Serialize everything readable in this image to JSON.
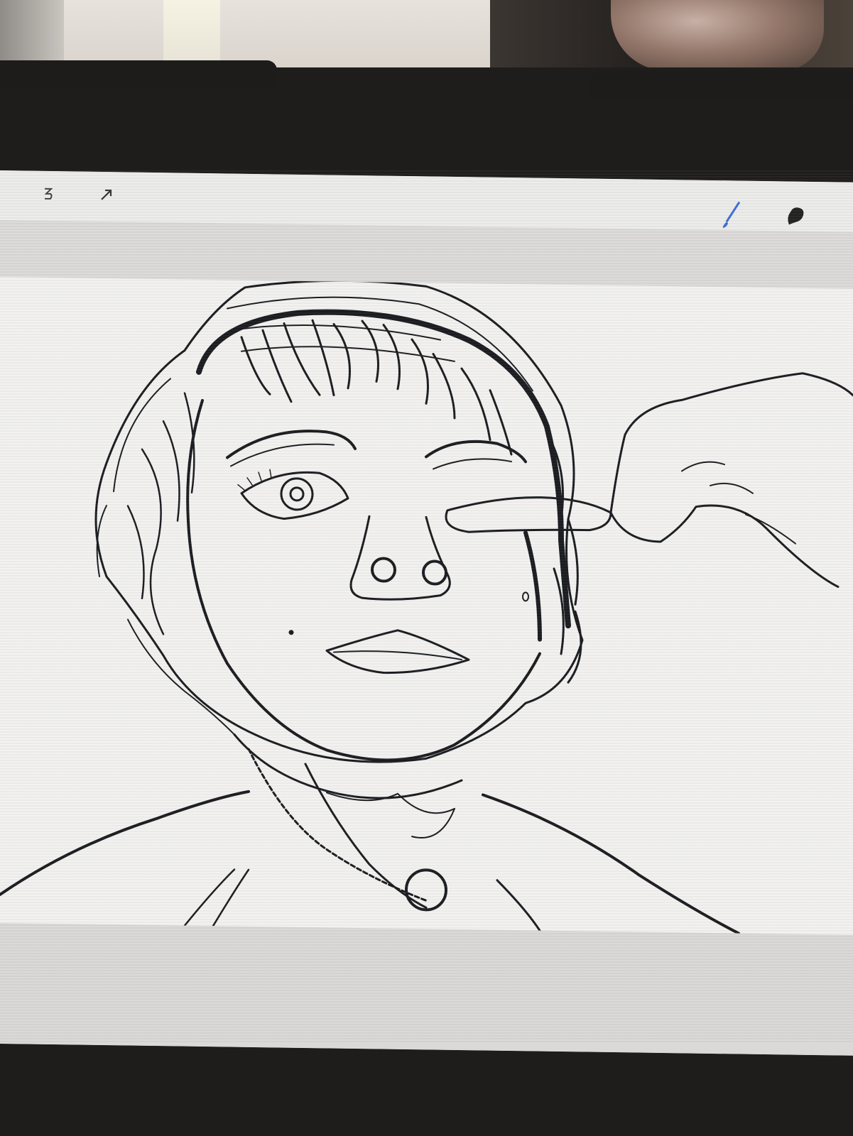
{
  "app": {
    "name": ""
  },
  "toolbar": {
    "undo_icon": "undo-icon",
    "transform_icon": "arrow-icon",
    "brush_icon": "brush-icon",
    "smudge_icon": "smudge-icon",
    "brush_color": "#3d6fd6"
  },
  "canvas": {
    "subject": ""
  }
}
